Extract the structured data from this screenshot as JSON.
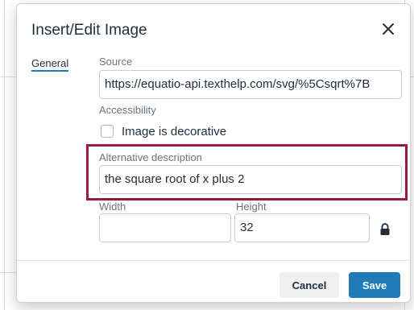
{
  "dialog": {
    "title": "Insert/Edit Image",
    "close_icon": "close-icon"
  },
  "tabs": [
    {
      "label": "General",
      "active": true
    }
  ],
  "form": {
    "source_label": "Source",
    "source_value": "https://equatio-api.texthelp.com/svg/%5Csqrt%7B",
    "accessibility_label": "Accessibility",
    "decorative_label": "Image is decorative",
    "decorative_checked": false,
    "alt_label": "Alternative description",
    "alt_value": "the square root of x plus 2",
    "width_label": "Width",
    "width_value": "",
    "height_label": "Height",
    "height_value": "32",
    "lock_icon": "lock-icon"
  },
  "footer": {
    "cancel_label": "Cancel",
    "save_label": "Save"
  },
  "colors": {
    "highlight": "#9c1a3e",
    "primary": "#207ab7",
    "text": "#222f3e"
  }
}
